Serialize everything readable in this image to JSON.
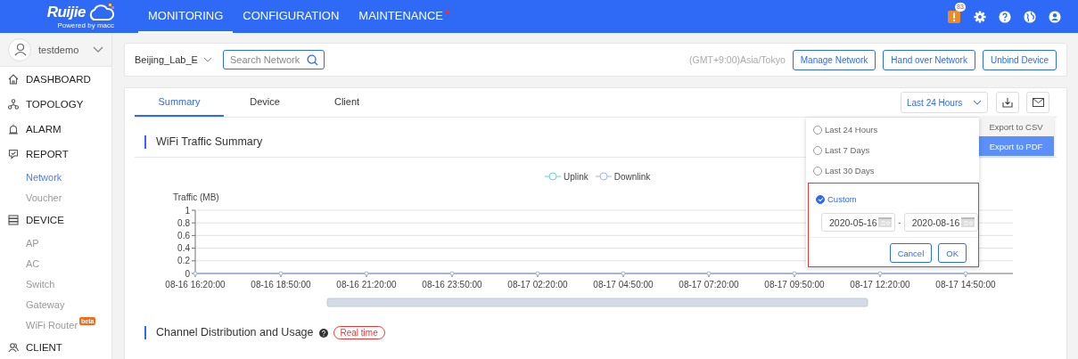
{
  "header": {
    "logo": {
      "wordmark": "Ruijie",
      "tagline": "Powered by macc"
    },
    "nav": [
      {
        "label": "MONITORING",
        "selected": true,
        "notification_dot": false
      },
      {
        "label": "CONFIGURATION",
        "selected": false,
        "notification_dot": false
      },
      {
        "label": "MAINTENANCE",
        "selected": false,
        "notification_dot": true
      }
    ],
    "alert_badge": "83"
  },
  "sidebar": {
    "user": "testdemo",
    "items": [
      {
        "label": "DASHBOARD",
        "selected": false
      },
      {
        "label": "TOPOLOGY",
        "selected": false
      },
      {
        "label": "ALARM",
        "selected": false
      },
      {
        "label": "REPORT",
        "selected": false,
        "children": [
          {
            "label": "Network",
            "selected": true
          },
          {
            "label": "Voucher",
            "selected": false
          }
        ]
      },
      {
        "label": "DEVICE",
        "selected": false,
        "children": [
          {
            "label": "AP",
            "selected": false
          },
          {
            "label": "AC",
            "selected": false
          },
          {
            "label": "Switch",
            "selected": false
          },
          {
            "label": "Gateway",
            "selected": false
          },
          {
            "label": "WiFi Router",
            "selected": false,
            "badge": "beta"
          }
        ]
      },
      {
        "label": "CLIENT",
        "selected": false
      }
    ]
  },
  "toolbar": {
    "network": "Beijing_Lab_E",
    "search": {
      "placeholder": "Search Network"
    },
    "timezone": "(GMT+9:00)Asia/Tokyo",
    "buttons": [
      "Manage Network",
      "Hand over Network",
      "Unbind Device"
    ]
  },
  "tabs": [
    {
      "label": "Summary",
      "selected": true
    },
    {
      "label": "Device",
      "selected": false
    },
    {
      "label": "Client",
      "selected": false
    }
  ],
  "range_select": {
    "value": "Last 24 Hours"
  },
  "export_menu": [
    {
      "label": "Export to CSV",
      "highlighted": false
    },
    {
      "label": "Export to PDF",
      "highlighted": true
    }
  ],
  "range_popover": {
    "options": [
      {
        "label": "Last 24 Hours",
        "selected": false
      },
      {
        "label": "Last 7 Days",
        "selected": false
      },
      {
        "label": "Last 30 Days",
        "selected": false
      },
      {
        "label": "Custom",
        "selected": true
      }
    ],
    "start_date": "2020-05-16",
    "separator": "-",
    "end_date": "2020-08-16",
    "buttons": [
      "Cancel",
      "OK"
    ]
  },
  "traffic_section": {
    "title": "WiFi Traffic Summary",
    "chart_data": {
      "type": "line",
      "ylabel": "Traffic (MB)",
      "categories": [
        "08-16 16:20:00",
        "08-16 18:50:00",
        "08-16 21:20:00",
        "08-16 23:50:00",
        "08-17 02:20:00",
        "08-17 04:50:00",
        "08-17 07:20:00",
        "08-17 09:50:00",
        "08-17 12:20:00",
        "08-17 14:50:00"
      ],
      "series": [
        {
          "name": "Uplink",
          "color": "#62d5d0",
          "marker": "circle",
          "values": [
            null,
            null,
            null,
            null,
            null,
            null,
            null,
            null,
            null,
            null
          ]
        },
        {
          "name": "Downlink",
          "color": "#9fb3e6",
          "marker": "circle",
          "values": [
            0,
            0,
            0,
            0,
            0,
            0,
            0,
            0,
            0,
            0
          ]
        }
      ],
      "grid": true,
      "legend": true,
      "ylim": [
        0,
        1
      ],
      "yticks": [
        0,
        0.2,
        0.4,
        0.6,
        0.8,
        1
      ]
    }
  },
  "channel_section": {
    "title": "Channel Distribution and Usage",
    "badge": "Real time"
  }
}
